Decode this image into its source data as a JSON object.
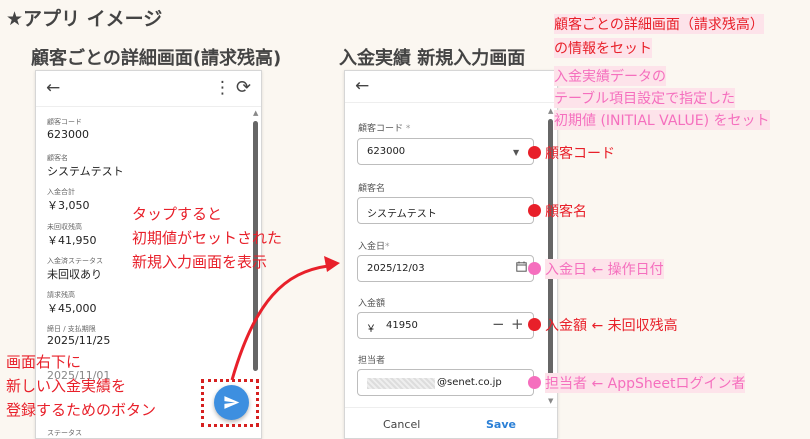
{
  "title": "★アプリ イメージ",
  "left_section": {
    "title": "顧客ごとの詳細画面(請求残高)",
    "appbar": {
      "back_icon": "←",
      "more_icon": "⋮",
      "refresh_icon": "⟳"
    },
    "fields": [
      {
        "label": "顧客コード",
        "value": "623000"
      },
      {
        "label": "顧客名",
        "value": "システムテスト"
      },
      {
        "label": "入金合計",
        "value": "￥3,050"
      },
      {
        "label": "未回収残高",
        "value": "￥41,950"
      },
      {
        "label": "入金済ステータス",
        "value": "未回収あり"
      },
      {
        "label": "請求残高",
        "value": "￥45,000"
      },
      {
        "label": "締日 / 支払期限",
        "value": "2025/11/25"
      }
    ],
    "cut_off_value": "2025/11/01",
    "cut_off_label": "ステータス"
  },
  "right_section": {
    "title": "入金実績 新規入力画面",
    "back_icon": "←",
    "form": {
      "customer_code": {
        "label": "顧客コード",
        "required": "*",
        "value": "623000"
      },
      "customer_name": {
        "label": "顧客名",
        "value": "システムテスト"
      },
      "date": {
        "label": "入金日",
        "required": "*",
        "value": "2025/12/03"
      },
      "amount": {
        "label": "入金額",
        "currency": "￥",
        "value": "41950",
        "minus": "−",
        "plus": "+"
      },
      "person": {
        "label": "担当者",
        "value": "@senet.co.jp"
      }
    },
    "cancel_label": "Cancel",
    "save_label": "Save"
  },
  "tap_note": [
    "タップすると",
    "初期値がセットされた",
    "新規入力画面を表示"
  ],
  "button_note": [
    "画面右下に",
    "新しい入金実績を",
    "登録するためのボタン"
  ],
  "top_note_red": [
    "顧客ごとの詳細画面（請求残高）",
    "の情報をセット"
  ],
  "top_note_pink": [
    "入金実績データの",
    "テーブル項目設定で指定した",
    "初期値 (INITIAL VALUE) をセット"
  ],
  "annotations": {
    "code": "顧客コード",
    "name": "顧客名",
    "date": "入金日 ← 操作日付",
    "amount": "入金額 ← 未回収残高",
    "person": "担当者 ← AppSheetログイン者"
  },
  "colors": {
    "red": "#e8202a",
    "pink": "#f56fbe",
    "pink_bg": "#fde3ea",
    "fab": "#3d8fe0",
    "save": "#2a7fd6"
  }
}
